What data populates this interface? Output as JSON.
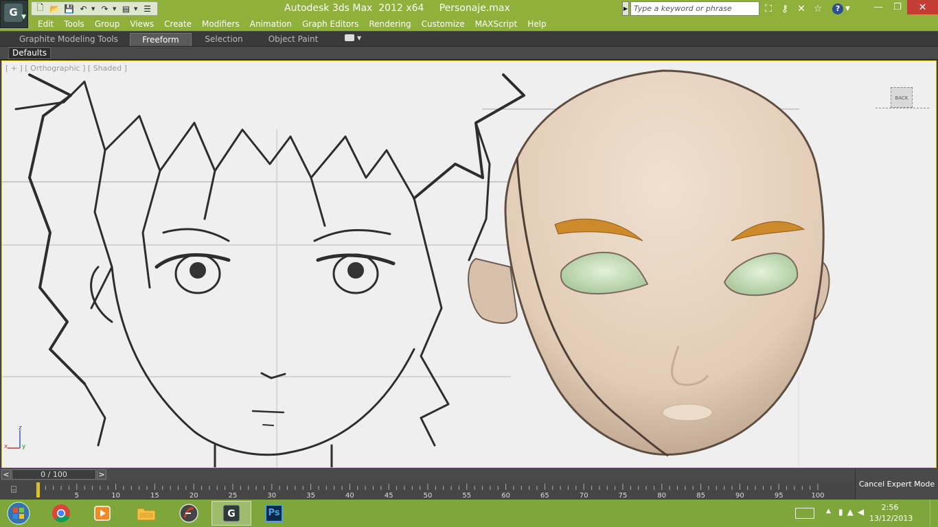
{
  "title": {
    "app": "Autodesk 3ds Max  2012 x64",
    "file": "Personaje.max",
    "search_placeholder": "Type a keyword or phrase"
  },
  "menu": [
    "Edit",
    "Tools",
    "Group",
    "Views",
    "Create",
    "Modifiers",
    "Animation",
    "Graph Editors",
    "Rendering",
    "Customize",
    "MAXScript",
    "Help"
  ],
  "ribbon": {
    "tabs": [
      "Graphite Modeling Tools",
      "Freeform",
      "Selection",
      "Object Paint"
    ],
    "active_tab": "Freeform",
    "panel_label": "Defaults"
  },
  "viewport": {
    "label": "[ + ] [ Orthographic ] [ Shaded ]",
    "viewcube_face": "BACK",
    "axis": {
      "z": "z",
      "x": "x",
      "y": "y"
    },
    "colors": {
      "skin": "#e6d2bf",
      "eyebrow": "#cc8a2a",
      "eye": "#cfe6c4",
      "border": "#e0c21e"
    }
  },
  "timeline": {
    "frame_display": "0 / 100",
    "prev": "<",
    "next": ">",
    "ticks": [
      "5",
      "10",
      "15",
      "20",
      "25",
      "30",
      "35",
      "40",
      "45",
      "50",
      "55",
      "60",
      "65",
      "70",
      "75",
      "80",
      "85",
      "90",
      "95",
      "100"
    ]
  },
  "expert_mode_button": "Cancel Expert Mode",
  "taskbar": {
    "apps": [
      "windows-start",
      "chrome",
      "media-player",
      "file-explorer",
      "adobe-flash",
      "3ds-max",
      "photoshop"
    ],
    "photoshop_label": "Ps",
    "time": "2:56",
    "date": "13/12/2013"
  }
}
